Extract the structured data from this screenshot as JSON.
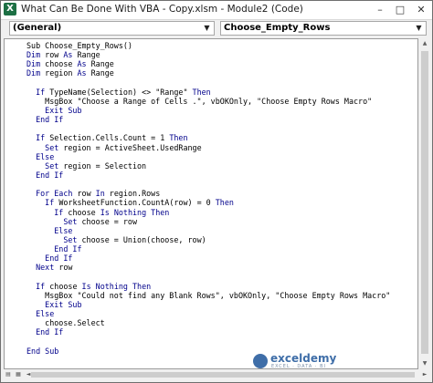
{
  "window": {
    "title": "What Can Be Done With VBA - Copy.xlsm - Module2 (Code)",
    "minimize": "–",
    "maximize": "□",
    "close": "✕"
  },
  "toolbar": {
    "object_combo": "(General)",
    "procedure_combo": "Choose_Empty_Rows",
    "dropdown_icon": "▼"
  },
  "colors": {
    "keyword": "#00008b",
    "text": "#000000",
    "excel_green": "#1d7044"
  },
  "code_lines": [
    [
      {
        "t": "Sub Choose_Empty_Rows()"
      }
    ],
    [
      {
        "t": "Dim ",
        "k": 1
      },
      {
        "t": "row "
      },
      {
        "t": "As ",
        "k": 1
      },
      {
        "t": "Range"
      }
    ],
    [
      {
        "t": "Dim ",
        "k": 1
      },
      {
        "t": "choose "
      },
      {
        "t": "As ",
        "k": 1
      },
      {
        "t": "Range"
      }
    ],
    [
      {
        "t": "Dim ",
        "k": 1
      },
      {
        "t": "region "
      },
      {
        "t": "As ",
        "k": 1
      },
      {
        "t": "Range"
      }
    ],
    [
      {
        "t": ""
      }
    ],
    [
      {
        "t": "  "
      },
      {
        "t": "If ",
        "k": 1
      },
      {
        "t": "TypeName(Selection) <> \"Range\" "
      },
      {
        "t": "Then",
        "k": 1
      }
    ],
    [
      {
        "t": "    MsgBox \"Choose a Range of Cells .\", vbOKOnly, \"Choose Empty Rows Macro\""
      }
    ],
    [
      {
        "t": "    "
      },
      {
        "t": "Exit Sub",
        "k": 1
      }
    ],
    [
      {
        "t": "  "
      },
      {
        "t": "End If",
        "k": 1
      }
    ],
    [
      {
        "t": ""
      }
    ],
    [
      {
        "t": "  "
      },
      {
        "t": "If ",
        "k": 1
      },
      {
        "t": "Selection.Cells.Count = 1 "
      },
      {
        "t": "Then",
        "k": 1
      }
    ],
    [
      {
        "t": "    "
      },
      {
        "t": "Set ",
        "k": 1
      },
      {
        "t": "region = ActiveSheet.UsedRange"
      }
    ],
    [
      {
        "t": "  "
      },
      {
        "t": "Else",
        "k": 1
      }
    ],
    [
      {
        "t": "    "
      },
      {
        "t": "Set ",
        "k": 1
      },
      {
        "t": "region = Selection"
      }
    ],
    [
      {
        "t": "  "
      },
      {
        "t": "End If",
        "k": 1
      }
    ],
    [
      {
        "t": ""
      }
    ],
    [
      {
        "t": "  "
      },
      {
        "t": "For Each ",
        "k": 1
      },
      {
        "t": "row "
      },
      {
        "t": "In ",
        "k": 1
      },
      {
        "t": "region.Rows"
      }
    ],
    [
      {
        "t": "    "
      },
      {
        "t": "If ",
        "k": 1
      },
      {
        "t": "WorksheetFunction.CountA(row) = 0 "
      },
      {
        "t": "Then",
        "k": 1
      }
    ],
    [
      {
        "t": "      "
      },
      {
        "t": "If ",
        "k": 1
      },
      {
        "t": "choose "
      },
      {
        "t": "Is Nothing Then",
        "k": 1
      }
    ],
    [
      {
        "t": "        "
      },
      {
        "t": "Set ",
        "k": 1
      },
      {
        "t": "choose = row"
      }
    ],
    [
      {
        "t": "      "
      },
      {
        "t": "Else",
        "k": 1
      }
    ],
    [
      {
        "t": "        "
      },
      {
        "t": "Set ",
        "k": 1
      },
      {
        "t": "choose = Union(choose, row)"
      }
    ],
    [
      {
        "t": "      "
      },
      {
        "t": "End If",
        "k": 1
      }
    ],
    [
      {
        "t": "    "
      },
      {
        "t": "End If",
        "k": 1
      }
    ],
    [
      {
        "t": "  "
      },
      {
        "t": "Next ",
        "k": 1
      },
      {
        "t": "row"
      }
    ],
    [
      {
        "t": ""
      }
    ],
    [
      {
        "t": "  "
      },
      {
        "t": "If ",
        "k": 1
      },
      {
        "t": "choose "
      },
      {
        "t": "Is Nothing Then",
        "k": 1
      }
    ],
    [
      {
        "t": "    MsgBox \"Could not find any Blank Rows\", vbOKOnly, \"Choose Empty Rows Macro\""
      }
    ],
    [
      {
        "t": "    "
      },
      {
        "t": "Exit Sub",
        "k": 1
      }
    ],
    [
      {
        "t": "  "
      },
      {
        "t": "Else",
        "k": 1
      }
    ],
    [
      {
        "t": "    choose.Select"
      }
    ],
    [
      {
        "t": "  "
      },
      {
        "t": "End If",
        "k": 1
      }
    ],
    [
      {
        "t": ""
      }
    ],
    [
      {
        "t": "End Sub",
        "k": 1
      }
    ]
  ],
  "watermark": {
    "name": "exceldemy",
    "tagline": "EXCEL · DATA · BI"
  }
}
